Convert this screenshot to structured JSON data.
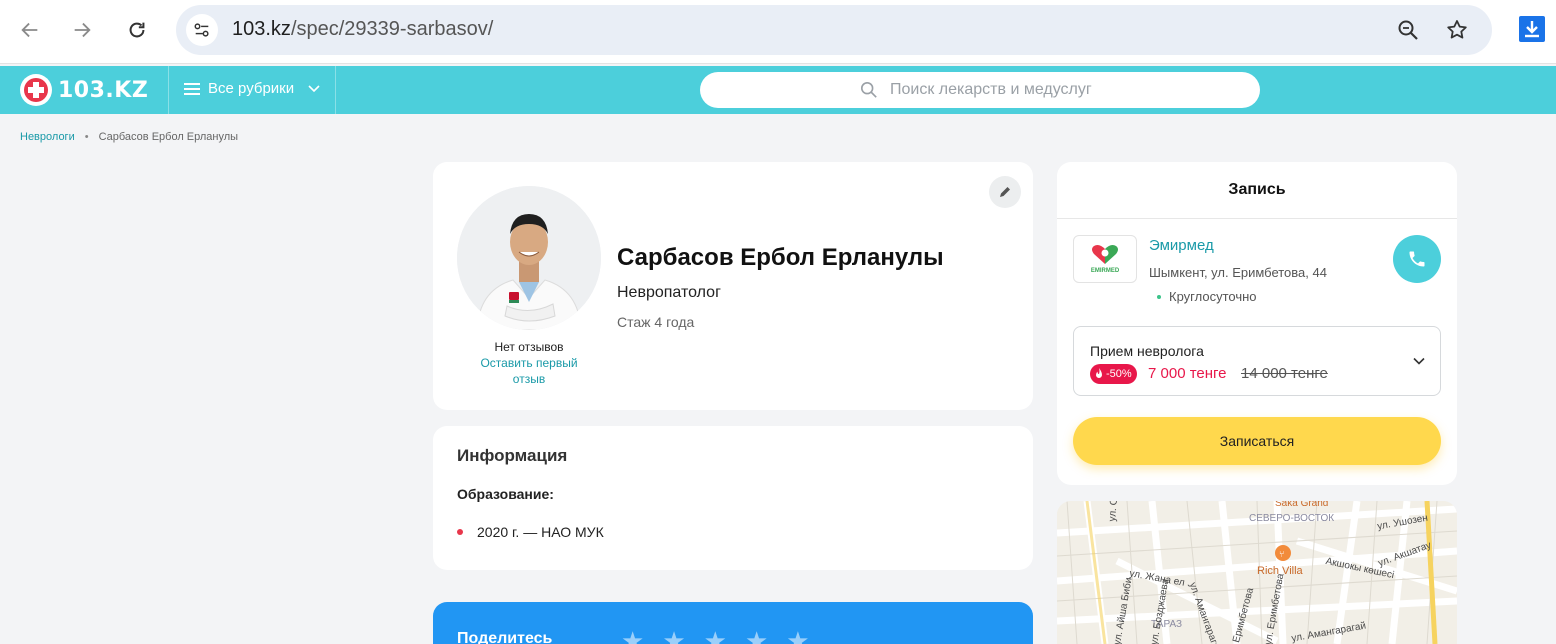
{
  "browser": {
    "url_host": "103.kz",
    "url_path": "/spec/29339-sarbasov/"
  },
  "header": {
    "logo_text": "103.KZ",
    "rubrics_label": "Все рубрики",
    "search_placeholder": "Поиск лекарств и медуслуг"
  },
  "breadcrumb": {
    "parent": "Неврологи",
    "current": "Сарбасов Ербол Ерланулы"
  },
  "doctor": {
    "name": "Сарбасов Ербол Ерланулы",
    "specialty": "Невропатолог",
    "experience": "Стаж 4 года",
    "no_reviews": "Нет отзывов",
    "leave_review": "Оставить первый отзыв"
  },
  "info": {
    "title": "Информация",
    "education_label": "Образование:",
    "education": [
      "2020 г. — НАО МУК"
    ]
  },
  "share": {
    "title": "Поделитесь",
    "stars": 5
  },
  "booking": {
    "title": "Запись",
    "clinic_logo_text": "EMIRMED",
    "clinic_name": "Эмирмед",
    "clinic_address": "Шымкент, ул. Еримбетова, 44",
    "clinic_hours": "Круглосуточно",
    "service_name": "Прием невролога",
    "discount": "-50%",
    "price_new": "7 000 тенге",
    "price_old": "14 000 тенге",
    "book_label": "Записаться"
  },
  "map": {
    "labels": [
      "Saka Grand",
      "СЕВЕРО-ВОСТОК",
      "ул. Ушозен",
      "ул. Акшатау",
      "Rich Villa",
      "Акшокы көшесі",
      "ул. Жана ел",
      "ул. Амангарагай",
      "ул. Амангарагай",
      "ул. Сейдуллы Байтерекова",
      "ул. Айша Биби",
      "ТАРАЗ",
      "Еримбетова",
      "ул. Еримбетова",
      "ул. Бозджаева"
    ]
  },
  "colors": {
    "brand": "#4ccfdb",
    "accent_red": "#e8174a",
    "cta_yellow": "#ffd84d",
    "link": "#1a9aa8",
    "share_blue": "#2196f3"
  }
}
